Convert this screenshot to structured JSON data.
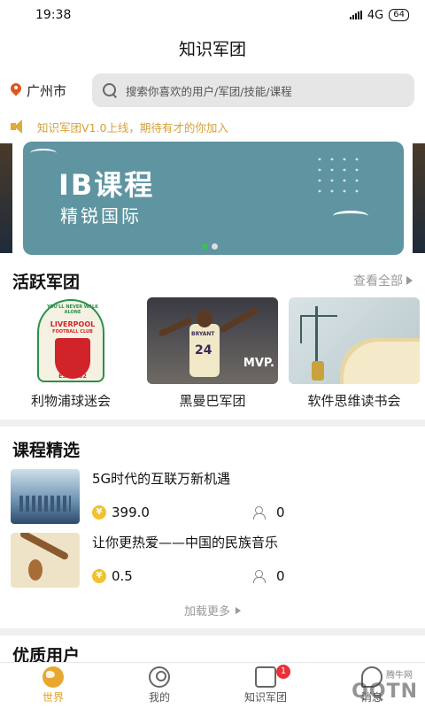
{
  "status": {
    "time": "19:38",
    "network": "4G",
    "battery": "64"
  },
  "header": {
    "title": "知识军团"
  },
  "location": {
    "city": "广州市"
  },
  "search": {
    "placeholder": "搜索你喜欢的用户/军团/技能/课程"
  },
  "notice": {
    "text": "知识军团V1.0上线，期待有才的你加入"
  },
  "banner": {
    "title": "IB课程",
    "subtitle": "精锐国际",
    "active_index": 0,
    "count": 2
  },
  "active_groups": {
    "title": "活跃军团",
    "more": "查看全部",
    "items": [
      {
        "name": "利物浦球迷会",
        "image": "liverpool-crest",
        "crest_line1": "LIVERPOOL",
        "crest_line2": "FOOTBALL CLUB",
        "crest_motto": "YOU'LL NEVER WALK ALONE",
        "crest_year": "EST·1892"
      },
      {
        "name": "黑曼巴军团",
        "image": "basketball-player",
        "jersey": "24",
        "jersey_name": "BRYANT",
        "caption": "MVP."
      },
      {
        "name": "软件思维读书会",
        "image": "book-tree"
      }
    ]
  },
  "courses": {
    "title": "课程精选",
    "items": [
      {
        "title": "5G时代的互联万新机遇",
        "price": "399.0",
        "people": "0",
        "thumb": "city-skyline"
      },
      {
        "title": "让你更热爱——中国的民族音乐",
        "price": "0.5",
        "people": "0",
        "thumb": "instruments"
      }
    ],
    "load_more": "加载更多"
  },
  "users": {
    "title": "优质用户"
  },
  "tabs": [
    {
      "label": "世界",
      "icon": "globe-icon",
      "active": true
    },
    {
      "label": "我的",
      "icon": "user-icon",
      "active": false
    },
    {
      "label": "知识军团",
      "icon": "group-icon",
      "active": false,
      "badge": "1"
    },
    {
      "label": "消息",
      "icon": "message-icon",
      "active": false
    }
  ],
  "watermark": {
    "logo": "QQTN",
    "site": "腾牛网"
  },
  "colors": {
    "accent": "#e0a02a",
    "banner": "#5f94a1",
    "notice": "#d4a13a",
    "badge": "#e8323a"
  }
}
